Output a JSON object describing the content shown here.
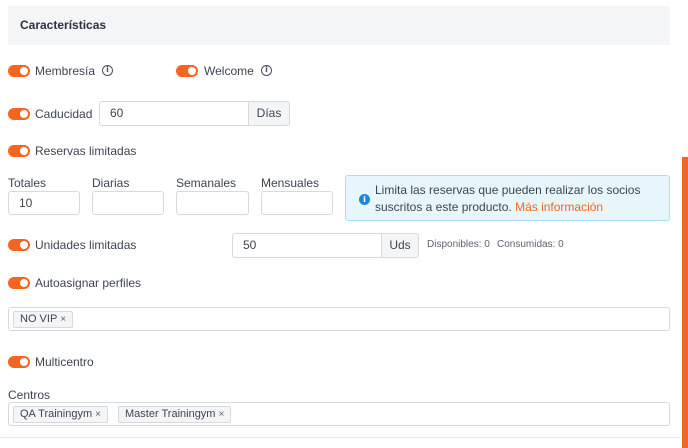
{
  "section": {
    "title": "Características"
  },
  "membresia": {
    "label": "Membresía"
  },
  "welcome": {
    "label": "Welcome"
  },
  "caducidad": {
    "label": "Caducidad",
    "value": "60",
    "unit": "Días"
  },
  "reservas": {
    "label": "Reservas limitadas",
    "fields": [
      {
        "label": "Totales",
        "value": "10"
      },
      {
        "label": "Diarias",
        "value": ""
      },
      {
        "label": "Semanales",
        "value": ""
      },
      {
        "label": "Mensuales",
        "value": ""
      }
    ],
    "info_text": "Limita las reservas que pueden realizar los socios suscritos a este producto.",
    "info_link": "Más información"
  },
  "unidades": {
    "label": "Unidades limitadas",
    "value": "50",
    "unit": "Uds",
    "disponibles": "Disponibles: 0",
    "consumidas": "Consumidas: 0"
  },
  "autoasignar": {
    "label": "Autoasignar perfiles",
    "chips": [
      "NO VIP"
    ]
  },
  "multicentro": {
    "label": "Multicentro"
  },
  "centros": {
    "label": "Centros",
    "chips": [
      "QA Trainingym",
      "Master Trainingym"
    ]
  },
  "icons": {
    "remove": "×"
  },
  "colors": {
    "accent": "#f26522",
    "info": "#1e88d7",
    "info_bg": "#e6f6fb"
  }
}
